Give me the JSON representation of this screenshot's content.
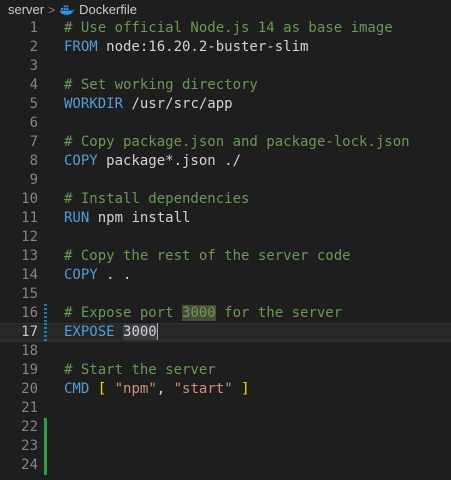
{
  "breadcrumb": {
    "folder": "server",
    "separator": ">",
    "file": "Dockerfile",
    "file_icon": "docker-icon"
  },
  "editor": {
    "current_line": 17,
    "lines": [
      {
        "n": "1",
        "code": [
          {
            "t": "# Use official Node.js 14 as base image",
            "c": "cmt"
          }
        ]
      },
      {
        "n": "2",
        "code": [
          {
            "t": "FROM",
            "c": "kw"
          },
          {
            "t": " node:16.20.2-buster-slim",
            "c": ""
          }
        ]
      },
      {
        "n": "3",
        "code": []
      },
      {
        "n": "4",
        "code": [
          {
            "t": "# Set working directory",
            "c": "cmt"
          }
        ]
      },
      {
        "n": "5",
        "code": [
          {
            "t": "WORKDIR",
            "c": "kw"
          },
          {
            "t": " /usr/src/app",
            "c": ""
          }
        ]
      },
      {
        "n": "6",
        "code": []
      },
      {
        "n": "7",
        "code": [
          {
            "t": "# Copy package.json and package-lock.json",
            "c": "cmt"
          }
        ]
      },
      {
        "n": "8",
        "code": [
          {
            "t": "COPY",
            "c": "kw"
          },
          {
            "t": " package*.json ./",
            "c": ""
          }
        ]
      },
      {
        "n": "9",
        "code": []
      },
      {
        "n": "10",
        "code": [
          {
            "t": "# Install dependencies",
            "c": "cmt"
          }
        ]
      },
      {
        "n": "11",
        "code": [
          {
            "t": "RUN",
            "c": "kw"
          },
          {
            "t": " npm install",
            "c": ""
          }
        ]
      },
      {
        "n": "12",
        "code": []
      },
      {
        "n": "13",
        "code": [
          {
            "t": "# Copy the rest of the server code",
            "c": "cmt"
          }
        ]
      },
      {
        "n": "14",
        "code": [
          {
            "t": "COPY",
            "c": "kw"
          },
          {
            "t": " . .",
            "c": ""
          }
        ]
      },
      {
        "n": "15",
        "code": []
      },
      {
        "n": "16",
        "gutter": "modified",
        "code": [
          {
            "t": "# Expose port ",
            "c": "cmt"
          },
          {
            "t": "3000",
            "c": "cmt hl-strong"
          },
          {
            "t": " for the server",
            "c": "cmt"
          }
        ]
      },
      {
        "n": "17",
        "gutter": "modified",
        "code": [
          {
            "t": "EXPOSE",
            "c": "kw"
          },
          {
            "t": " ",
            "c": ""
          },
          {
            "t": "3000",
            "c": "hl"
          }
        ],
        "cursor": true
      },
      {
        "n": "18",
        "code": []
      },
      {
        "n": "19",
        "code": [
          {
            "t": "# Start the server",
            "c": "cmt"
          }
        ]
      },
      {
        "n": "20",
        "code": [
          {
            "t": "CMD",
            "c": "kw"
          },
          {
            "t": " ",
            "c": ""
          },
          {
            "t": "[",
            "c": "punc"
          },
          {
            "t": " ",
            "c": ""
          },
          {
            "t": "\"npm\"",
            "c": "str"
          },
          {
            "t": ", ",
            "c": ""
          },
          {
            "t": "\"start\"",
            "c": "str"
          },
          {
            "t": " ",
            "c": ""
          },
          {
            "t": "]",
            "c": "punc"
          }
        ]
      },
      {
        "n": "21",
        "code": []
      },
      {
        "n": "22",
        "gutter": "added",
        "code": []
      },
      {
        "n": "23",
        "gutter": "added",
        "code": []
      },
      {
        "n": "24",
        "gutter": "added",
        "code": []
      }
    ]
  }
}
